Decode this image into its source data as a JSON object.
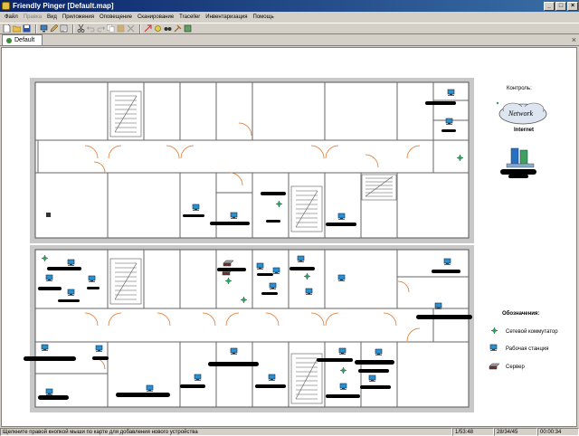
{
  "window": {
    "title": "Friendly Pinger [Default.map]"
  },
  "menu": [
    {
      "label": "Файл",
      "enabled": true
    },
    {
      "label": "Правка",
      "enabled": false
    },
    {
      "label": "Вид",
      "enabled": true
    },
    {
      "label": "Приложения",
      "enabled": true
    },
    {
      "label": "Оповещение",
      "enabled": true
    },
    {
      "label": "Сканирование",
      "enabled": true
    },
    {
      "label": "Traceller",
      "enabled": true
    },
    {
      "label": "Инвентаризация",
      "enabled": true
    },
    {
      "label": "Помощь",
      "enabled": true
    }
  ],
  "tabs": [
    {
      "label": "Default"
    }
  ],
  "map": {
    "network_box": {
      "title": "Контроль:",
      "cloud_label": "Network",
      "internet_label": "Internet"
    },
    "legend": {
      "title": "Обозначения:",
      "items": [
        {
          "label": "Сетевой коммутатор",
          "icon": "switch-icon"
        },
        {
          "label": "Рабочая станция",
          "icon": "workstation-icon"
        },
        {
          "label": "Сервер",
          "icon": "server-icon"
        }
      ]
    }
  },
  "status": {
    "hint": "Щелкните правой кнопкой мыши по карте для добавления нового устройства",
    "count": "1/53:48",
    "ratio": "28/34/45",
    "time": "00:00:34"
  }
}
